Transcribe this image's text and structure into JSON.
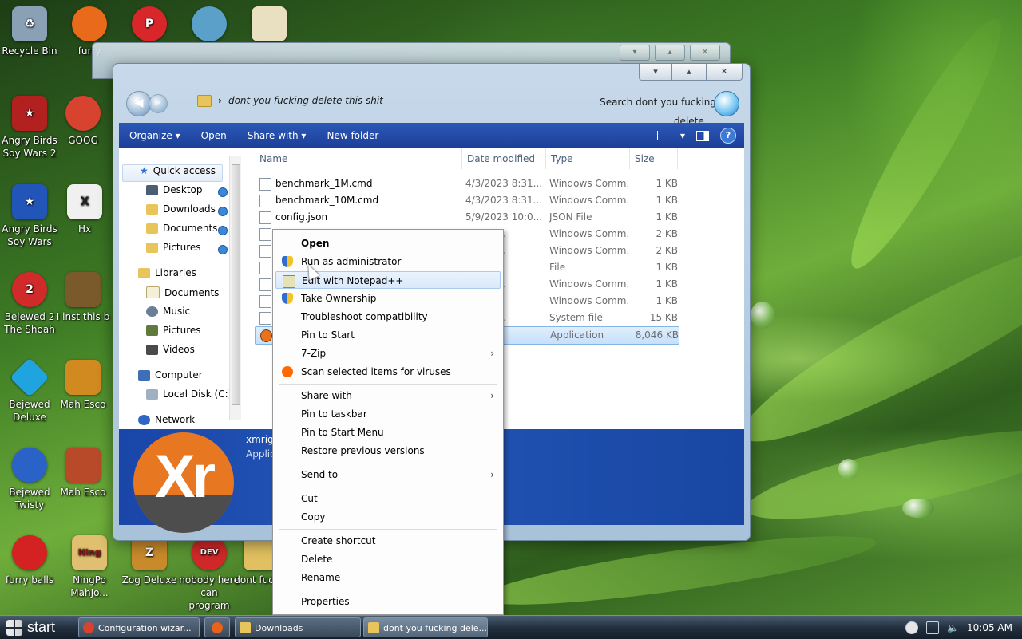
{
  "desktop": {
    "icons": [
      {
        "label": "Recycle Bin",
        "color": "#8aa1b5"
      },
      {
        "label": "furry",
        "color": "#e86a1a"
      },
      {
        "label": "Angry Birds Soy Wars 2",
        "color": "#b32020"
      },
      {
        "label": "GOOG",
        "color": "#d8432f"
      },
      {
        "label": "Angry Birds Soy Wars",
        "color": "#2156b8"
      },
      {
        "label": "Hx",
        "color": "#333333"
      },
      {
        "label": "Bejewed 2 The Shoah",
        "color": "#d12a2a"
      },
      {
        "label": "I inst this b",
        "color": "#7a5a2a"
      },
      {
        "label": "Bejewed Deluxe",
        "color": "#1fa4e0"
      },
      {
        "label": "Mah Esco",
        "color": "#d08a20"
      },
      {
        "label": "Bejewed Twisty",
        "color": "#2a62c8"
      },
      {
        "label": "Mah Esco",
        "color": "#b84a2a"
      },
      {
        "label": "furry balls",
        "color": "#d42222"
      },
      {
        "label": "NingPo MahJo...",
        "color": "#e0c070"
      },
      {
        "label": "Zog Deluxe",
        "color": "#c88a2a"
      },
      {
        "label": "nobody here can program",
        "color": "#d02828"
      },
      {
        "label": "dont fuckin",
        "color": "#e0c060"
      }
    ],
    "top_icons": [
      {
        "name": "firefox",
        "color": "#e8621a"
      },
      {
        "name": "p-app",
        "color": "#d8262a"
      },
      {
        "name": "game-1",
        "color": "#5aa0c8"
      },
      {
        "name": "game-2",
        "color": "#e8e0c0"
      }
    ]
  },
  "explorer": {
    "address_path": "dont you fucking delete this shit",
    "search_placeholder": "Search dont you fucking delete ...",
    "toolbar": {
      "organize": "Organize",
      "open": "Open",
      "share_with": "Share with",
      "new_folder": "New folder",
      "help": "?"
    },
    "window_controls": {
      "minimize": "▾",
      "maximize": "▴",
      "close": "✕"
    },
    "nav": {
      "quick_access": "Quick access",
      "desktop": "Desktop",
      "downloads": "Downloads",
      "documents": "Documents",
      "pictures": "Pictures",
      "libraries": "Libraries",
      "lib_documents": "Documents",
      "lib_music": "Music",
      "lib_pictures": "Pictures",
      "lib_videos": "Videos",
      "computer": "Computer",
      "local_disk": "Local Disk (C:)",
      "network": "Network"
    },
    "columns": {
      "name": "Name",
      "date": "Date modified",
      "type": "Type",
      "size": "Size"
    },
    "files": [
      {
        "name": "benchmark_1M.cmd",
        "date": "4/3/2023 8:31...",
        "type": "Windows Comm...",
        "size": "1 KB"
      },
      {
        "name": "benchmark_10M.cmd",
        "date": "4/3/2023 8:31...",
        "type": "Windows Comm...",
        "size": "1 KB"
      },
      {
        "name": "config.json",
        "date": "5/9/2023 10:0...",
        "type": "JSON File",
        "size": "1 KB"
      },
      {
        "name": "",
        "date": "3 8:31...",
        "type": "Windows Comm...",
        "size": "2 KB"
      },
      {
        "name": "",
        "date": "3 8:31...",
        "type": "Windows Comm...",
        "size": "2 KB"
      },
      {
        "name": "",
        "date": "3 8:3...",
        "type": "File",
        "size": "1 KB"
      },
      {
        "name": "",
        "date": "3 8:31...",
        "type": "Windows Comm...",
        "size": "1 KB"
      },
      {
        "name": "",
        "date": "3 8:3...",
        "type": "Windows Comm...",
        "size": "1 KB"
      },
      {
        "name": "",
        "date": "3 8:31...",
        "type": "System file",
        "size": "15 KB"
      },
      {
        "name": "Xr",
        "date": "3 8:3...",
        "type": "Application",
        "size": "8,046 KB"
      }
    ],
    "details": {
      "name": "xmrig",
      "kind": "Applic",
      "icon_text": "Xr"
    }
  },
  "context_menu": {
    "open": "Open",
    "run_as_admin": "Run as administrator",
    "edit_npp": "Edit with Notepad++",
    "take_ownership": "Take Ownership",
    "troubleshoot": "Troubleshoot compatibility",
    "pin_start": "Pin to Start",
    "zip": "7-Zip",
    "scan": "Scan selected items for viruses",
    "share_with": "Share with",
    "pin_taskbar": "Pin to taskbar",
    "pin_start_menu": "Pin to Start Menu",
    "restore": "Restore previous versions",
    "send_to": "Send to",
    "cut": "Cut",
    "copy": "Copy",
    "create_shortcut": "Create shortcut",
    "delete": "Delete",
    "rename": "Rename",
    "properties": "Properties",
    "submenu_arrow": "›"
  },
  "taskbar": {
    "start": "start",
    "buttons": [
      {
        "label": "Configuration wizar...",
        "color": "#d8432f"
      },
      {
        "label": "",
        "color": "#e8621a"
      },
      {
        "label": "Downloads",
        "color": "#e8c55a"
      },
      {
        "label": "dont you fucking dele...",
        "color": "#e8c55a"
      }
    ],
    "clock": "10:05 AM"
  }
}
